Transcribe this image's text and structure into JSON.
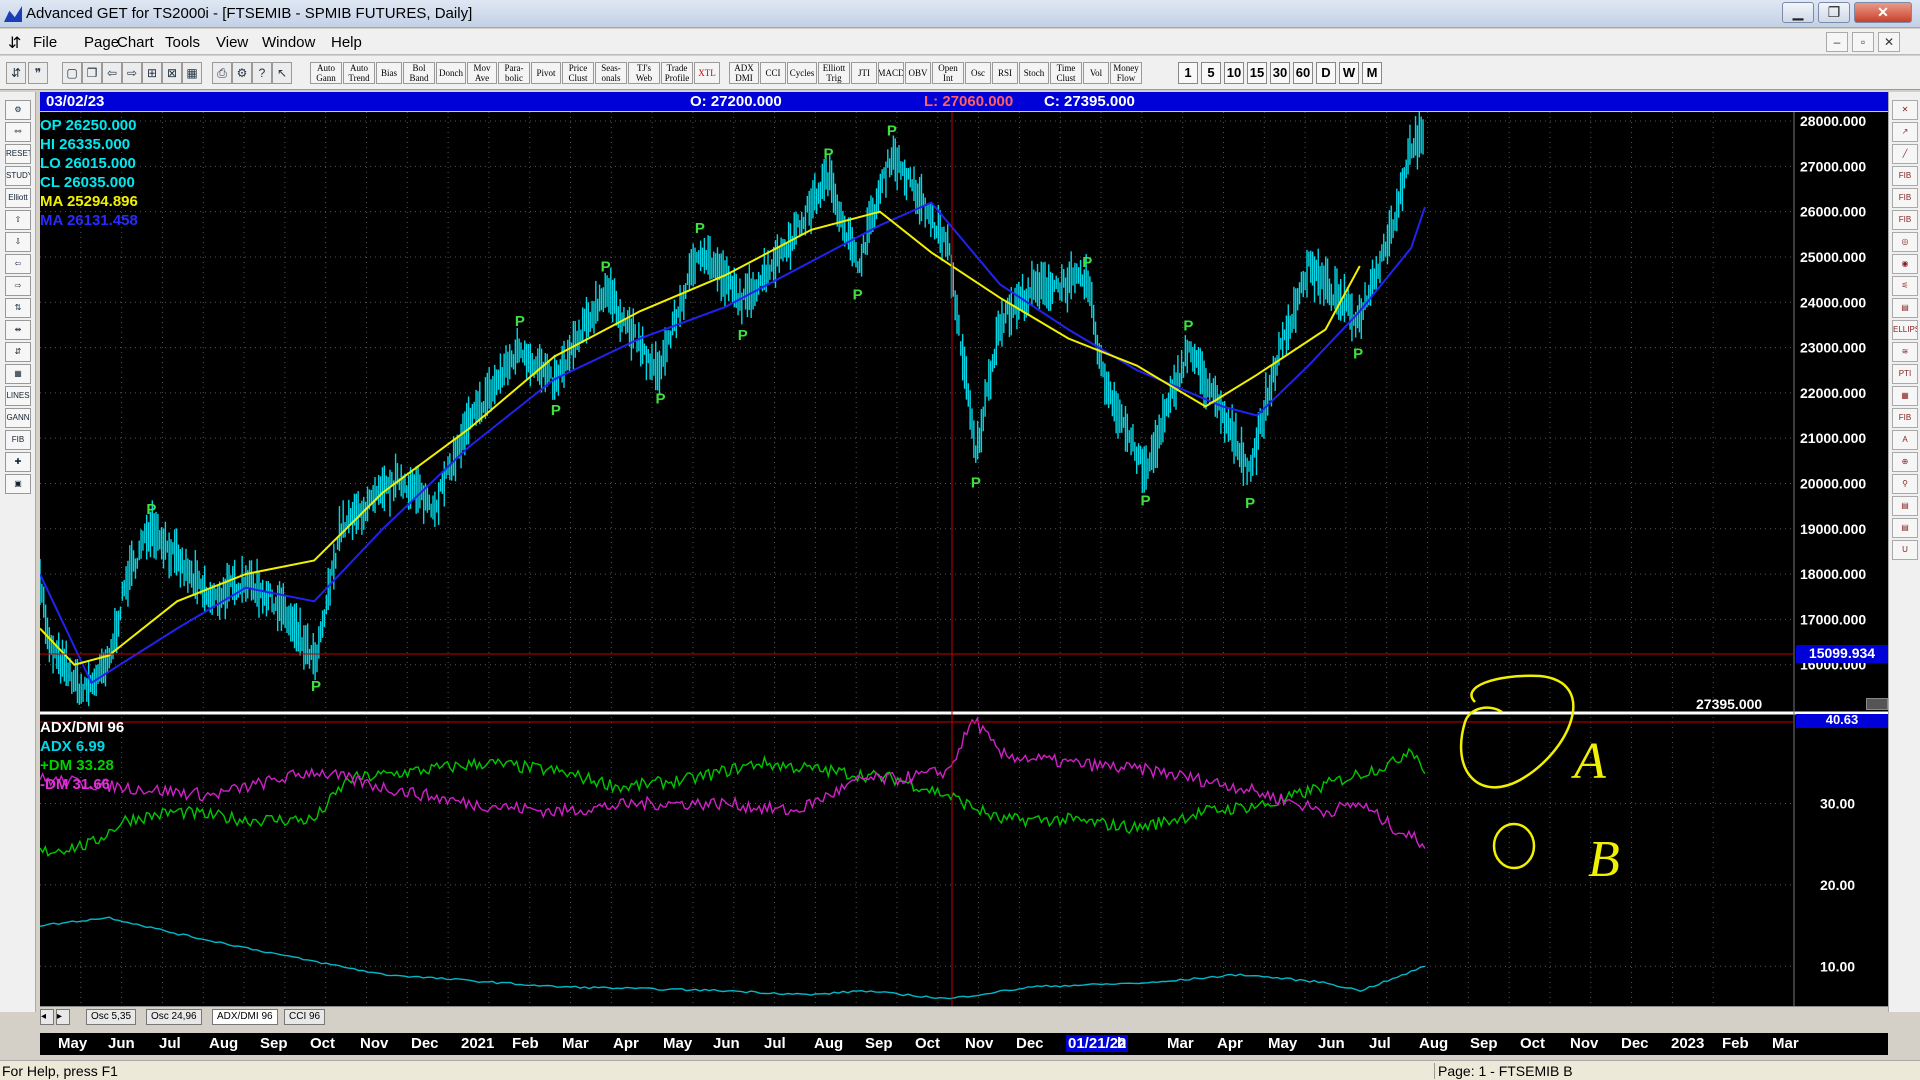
{
  "window": {
    "title": "Advanced GET for TS2000i - [FTSEMIB - SPMIB FUTURES, Daily]",
    "min": "▁",
    "max": "❐",
    "close": "✕"
  },
  "menu": [
    "File",
    "Page",
    "Chart",
    "Tools",
    "View",
    "Window",
    "Help"
  ],
  "mdi_controls": [
    "–",
    "▫",
    "✕"
  ],
  "toolbar": {
    "studies": [
      "Auto Gann",
      "Auto Trend",
      "Bias",
      "Bol Band",
      "Donch",
      "Mov Ave",
      "Para- bolic",
      "Pivot",
      "Price Clust",
      "Seas- onals",
      "TJ's Web",
      "Trade Profile",
      "XTL",
      "ADX DMI",
      "CCI",
      "Cycles",
      "Elliott Trig",
      "JTI",
      "MACD",
      "OBV",
      "Open Int",
      "Osc",
      "RSI",
      "Stoch",
      "Time Clust",
      "Vol",
      "Money Flow"
    ],
    "timeframes": [
      "1",
      "5",
      "10",
      "15",
      "30",
      "60",
      "D",
      "W",
      "M"
    ]
  },
  "leftbar": [
    "⚙",
    "⚯",
    "RESET",
    "STUDY",
    "Elliott",
    "⇧",
    "⇩",
    "⇦",
    "⇨",
    "⇅",
    "⇹",
    "⇵",
    "▦",
    "LINES",
    "GANN",
    "FIB",
    "✚",
    "▣"
  ],
  "rightbar": [
    "✕",
    "↗",
    "╱",
    "FIB RET",
    "FIB EXT",
    "FIB TIME",
    "◎",
    "◉",
    "⚟",
    "▤",
    "ELLIPS",
    "≋",
    "PTI",
    "▦",
    "FIB",
    "A",
    "⊕",
    "⚲",
    "▤",
    "▤",
    "U"
  ],
  "info": {
    "date": "03/02/23",
    "open": "O: 27200.000",
    "low": "L: 27060.000",
    "close": "C: 27395.000"
  },
  "price_panel": {
    "op": "OP  26250.000",
    "hi": "HI   26335.000",
    "lo": "LO  26015.000",
    "cl": "CL   26035.000",
    "ma1": "MA  25294.896",
    "ma2": "MA  26131.458",
    "axis_labels": [
      "28000.000",
      "27000.000",
      "26000.000",
      "25000.000",
      "24000.000",
      "23000.000",
      "22000.000",
      "21000.000",
      "20000.000",
      "19000.000",
      "18000.000",
      "17000.000",
      "16000.000"
    ],
    "cursor_price": "15099.934",
    "last_price": "27395.000",
    "pivot_marker": "P"
  },
  "indicator_panel": {
    "title": "ADX/DMI 96",
    "adx": "ADX 6.99",
    "pdm": "+DM 33.28",
    "mdm": "-DM 31.66",
    "axis_labels": [
      "30.00",
      "20.00",
      "10.00"
    ],
    "top_value": "40.63",
    "annotation_a": "A",
    "annotation_b": "B"
  },
  "tabs": [
    "Osc 5,35",
    "Osc 24,96",
    "ADX/DMI 96",
    "CCI 96"
  ],
  "dates": [
    "May",
    "Jun",
    "Jul",
    "Aug",
    "Sep",
    "Oct",
    "Nov",
    "Dec",
    "2021",
    "Feb",
    "Mar",
    "Apr",
    "May",
    "Jun",
    "Jul",
    "Aug",
    "Sep",
    "Oct",
    "Nov",
    "Dec",
    "01/21/22",
    "b",
    "Mar",
    "Apr",
    "May",
    "Jun",
    "Jul",
    "Aug",
    "Sep",
    "Oct",
    "Nov",
    "Dec",
    "2023",
    "Feb",
    "Mar"
  ],
  "status": {
    "help": "For Help, press F1",
    "page": "Page: 1 - FTSEMIB B"
  },
  "colors": {
    "price": "#00d8e8",
    "ma_yellow": "#f0f000",
    "ma_blue": "#2222ee",
    "pdm": "#00c800",
    "mdm": "#d020c8",
    "adx": "#00b8c8",
    "pivot": "#40e040",
    "cursor": "#c00000"
  },
  "chart_data": {
    "type": "line",
    "y_range": [
      15000,
      28200
    ],
    "indicator_range": [
      5,
      41
    ],
    "pivots": [
      {
        "x": 0.065,
        "y": 19150,
        "pos": "above"
      },
      {
        "x": 0.161,
        "y": 15900,
        "pos": "below"
      },
      {
        "x": 0.28,
        "y": 23300,
        "pos": "above"
      },
      {
        "x": 0.301,
        "y": 22000,
        "pos": "below"
      },
      {
        "x": 0.33,
        "y": 24500,
        "pos": "above"
      },
      {
        "x": 0.362,
        "y": 22250,
        "pos": "below"
      },
      {
        "x": 0.385,
        "y": 25350,
        "pos": "above"
      },
      {
        "x": 0.41,
        "y": 23650,
        "pos": "below"
      },
      {
        "x": 0.46,
        "y": 27000,
        "pos": "above"
      },
      {
        "x": 0.477,
        "y": 24550,
        "pos": "below"
      },
      {
        "x": 0.497,
        "y": 27500,
        "pos": "above"
      },
      {
        "x": 0.546,
        "y": 20400,
        "pos": "below"
      },
      {
        "x": 0.611,
        "y": 24600,
        "pos": "above"
      },
      {
        "x": 0.645,
        "y": 20000,
        "pos": "below"
      },
      {
        "x": 0.67,
        "y": 23200,
        "pos": "above"
      },
      {
        "x": 0.706,
        "y": 19950,
        "pos": "below"
      },
      {
        "x": 0.769,
        "y": 23250,
        "pos": "below"
      }
    ]
  }
}
